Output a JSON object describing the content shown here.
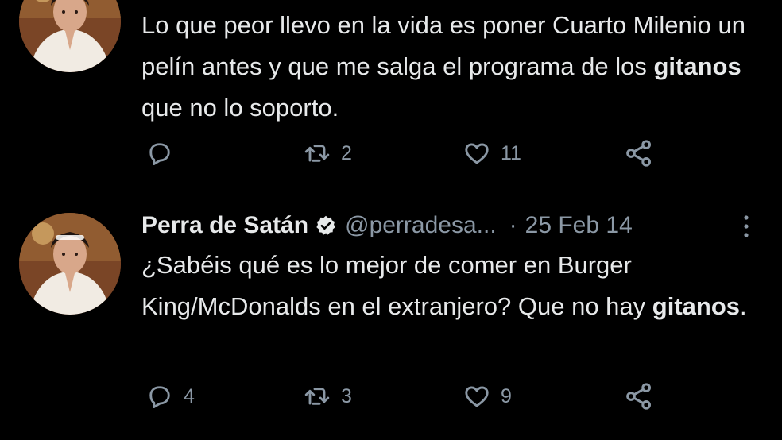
{
  "colors": {
    "background": "#000000",
    "text": "#e7e9ea",
    "secondary_text": "#8b98a5",
    "divider": "#2f3336"
  },
  "tweets": [
    {
      "text_before": "Lo que peor llevo en la vida es poner Cuarto Milenio un pelín antes y que me salga el programa de los ",
      "bold": "gitanos",
      "text_after": " que no lo soporto.",
      "reply_count": "",
      "retweet_count": "2",
      "like_count": "11"
    },
    {
      "display_name": "Perra de Satán",
      "handle": "@perradesa...",
      "separator": "·",
      "date": "25 Feb 14",
      "text_before": "¿Sabéis qué es lo mejor de comer en Burger King/McDonalds en el extranjero? Que no hay ",
      "bold": "gitanos",
      "text_after": ".",
      "reply_count": "4",
      "retweet_count": "3",
      "like_count": "9"
    }
  ],
  "icons": {
    "avatar": "avatar-portrait",
    "verified": "verified-badge-icon",
    "more": "more-options-icon",
    "reply": "reply-icon",
    "retweet": "retweet-icon",
    "like": "heart-icon",
    "share": "share-icon"
  }
}
